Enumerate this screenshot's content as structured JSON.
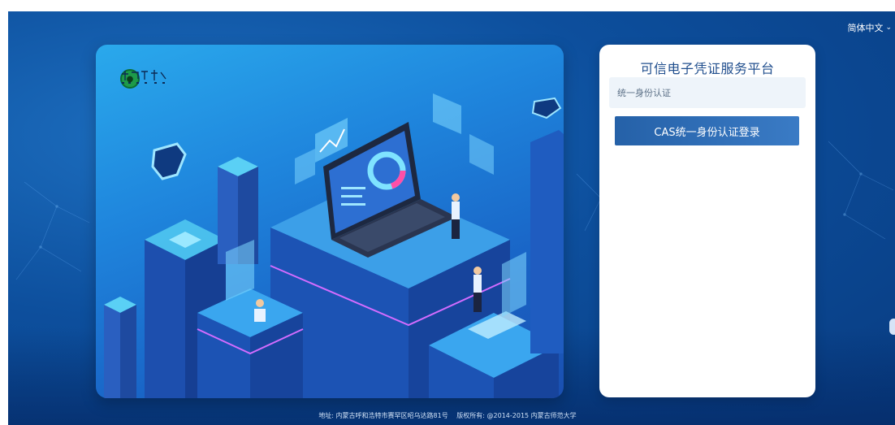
{
  "header": {
    "language": "简体中文"
  },
  "login": {
    "title": "可信电子凭证服务平台",
    "tab_label": "统一身份认证",
    "button_label": "CAS统一身份认证登录"
  },
  "footer": {
    "address": "地址: 内蒙古呼和浩特市赛罕区昭乌达路81号",
    "copyright": "版权所有: @2014-2015 内蒙古师范大学"
  },
  "icons": {
    "logo": "university-emblem-icon",
    "language_toggle": "chevron-down-icon"
  },
  "colors": {
    "background": "#0d4f9d",
    "hero": "#1f86dd",
    "title": "#214f8e",
    "button": "#2b67ae"
  }
}
